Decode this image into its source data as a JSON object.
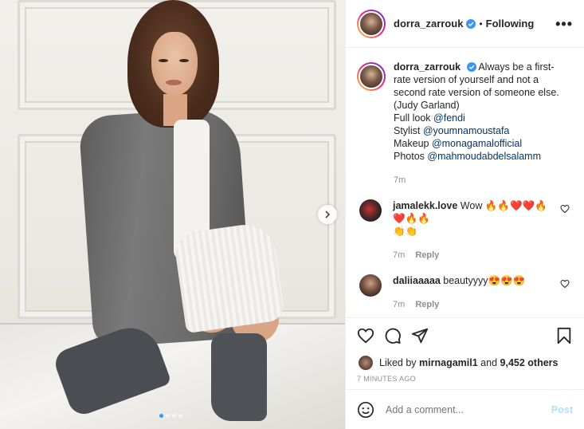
{
  "post": {
    "author": "dorra_zarrouk",
    "separator": "•",
    "follow_status": "Following",
    "more_label": "•••",
    "caption": {
      "line1": "Always be a first-",
      "line2": "rate version of yourself and not a",
      "line3": "second rate version of someone else.",
      "line4": "(Judy Garland)",
      "full_look_prefix": "Full look ",
      "full_look_mention": "@fendi",
      "stylist_prefix": "Stylist ",
      "stylist_mention": "@youmnamoustafa",
      "makeup_prefix": "Makeup ",
      "makeup_mention": "@monagamalofficial",
      "photos_prefix": "Photos ",
      "photos_mention": "@mahmoudabdelsalamm",
      "time": "7m"
    },
    "carousel": {
      "slides": 4,
      "active": 0
    }
  },
  "comments": [
    {
      "user": "jamalekk.love",
      "text": "Wow 🔥🔥❤️❤️🔥❤️🔥🔥",
      "text2": "👏👏",
      "time": "7m",
      "reply_label": "Reply"
    },
    {
      "user": "daliiaaaaa",
      "text": "beautyyyy😍😍😍",
      "time": "7m",
      "reply_label": "Reply"
    }
  ],
  "likes": {
    "prefix": "Liked by ",
    "user": "mirnagamil1",
    "suffix": " and ",
    "others": "9,452 others"
  },
  "time_ago": "7 MINUTES AGO",
  "comment_box": {
    "placeholder": "Add a comment...",
    "post_label": "Post"
  },
  "colors": {
    "link": "#00376b",
    "verified": "#3897f0",
    "muted": "#8e8e8e",
    "post_disabled": "#b2dffc"
  },
  "icons": [
    "verified-badge-icon",
    "more-options-icon",
    "chevron-right-icon",
    "heart-icon",
    "comment-icon",
    "share-icon",
    "bookmark-icon",
    "emoji-icon"
  ]
}
